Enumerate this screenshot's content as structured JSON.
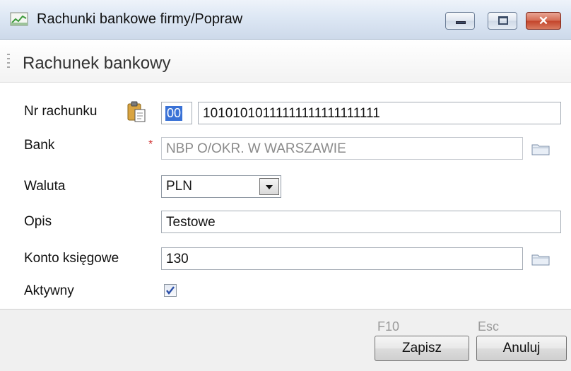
{
  "window": {
    "title": "Rachunki bankowe firmy/Popraw"
  },
  "section": {
    "title": "Rachunek bankowy"
  },
  "form": {
    "account_number": {
      "label": "Nr rachunku",
      "prefix": "00",
      "value": "10101010111111111111111111"
    },
    "bank": {
      "label": "Bank",
      "required_mark": "*",
      "value": "NBP O/OKR. W WARSZAWIE"
    },
    "currency": {
      "label": "Waluta",
      "value": "PLN"
    },
    "description": {
      "label": "Opis",
      "value": "Testowe"
    },
    "ledger_account": {
      "label": "Konto księgowe",
      "value": "130"
    },
    "active": {
      "label": "Aktywny",
      "checked": true
    }
  },
  "footer": {
    "save": {
      "shortcut": "F10",
      "label": "Zapisz"
    },
    "cancel": {
      "shortcut": "Esc",
      "label": "Anuluj"
    }
  },
  "icons": [
    "app-icon",
    "minimize-icon",
    "maximize-icon",
    "close-icon",
    "clipboard-icon",
    "folder-icon",
    "dropdown-arrow-icon",
    "checkmark-icon"
  ],
  "colors": {
    "selection": "#3a72d6",
    "required": "#d03030",
    "close_button": "#c2432a"
  }
}
